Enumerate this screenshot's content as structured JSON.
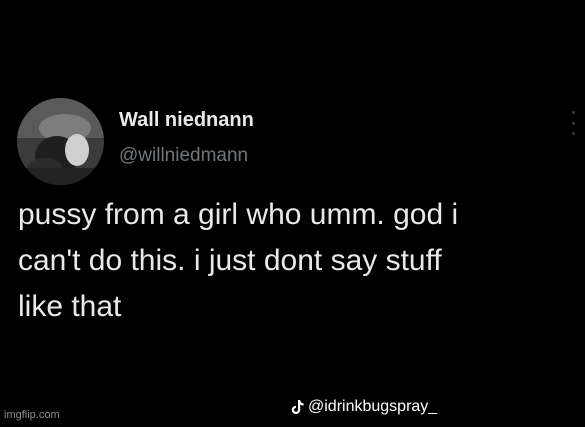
{
  "tweet": {
    "display_name": "Wall niednann",
    "handle": "@willniedmann",
    "text_lines": [
      "pussy from a girl who umm. god i",
      "can't do this. i just dont say stuff",
      "like that"
    ]
  },
  "credit": {
    "tiktok_icon": "tiktok-icon",
    "handle": "@idrinkbugspray_"
  },
  "watermark": "imgflip.com",
  "colors": {
    "background": "#000000",
    "primary_text": "#e7e9ea",
    "secondary_text": "#71767b"
  }
}
